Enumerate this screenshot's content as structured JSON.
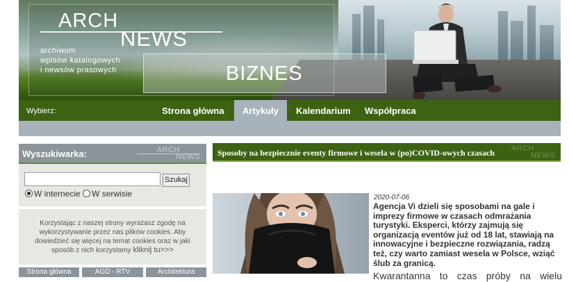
{
  "banner": {
    "logo_arch": "ARCH",
    "logo_news": "NEWS",
    "subtitle_lines": [
      "archiwum",
      "wpisów katalogowych",
      "i newsów prasowych"
    ],
    "section": "BIZNES"
  },
  "nav": {
    "prompt": "Wybierz:",
    "items": [
      "Strona główna",
      "Artykuły",
      "Kalendarium",
      "Współpraca"
    ],
    "active": "Artykuły"
  },
  "search": {
    "title": "Wyszukiwarka:",
    "mini_arch": "ARCH",
    "mini_news": "NEWS",
    "input_value": "",
    "button": "Szukaj",
    "option_internet": "W internecie",
    "option_site": "W serwisie",
    "selected": "W internecie"
  },
  "cookies": {
    "text": "Korzystając z naszej strony wyrażasz zgodę na wykorzystywanie przez nas plików cookies. Aby dowiedzieć się więcej na temat cookies oraz w jaki sposób z nich korzystamy",
    "link": "kliknij tu>>>"
  },
  "categories": [
    "Strona główna",
    "AGD - RTV",
    "Architektura"
  ],
  "article": {
    "title": "Sposoby na bezpiecznie eventy firmowe i wesela w (po)COVID-owych czasach",
    "bar_arch": "ARCH",
    "bar_news": "NEWS",
    "date": "2020-07-06",
    "lead": "Agencja Vi dzieli się sposobami na gale i imprezy firmowe w czasach odmrażania turystyki. Eksperci, którzy zajmują się organizacją eventów już od 18 lat, stawiają na innowacyjne i bezpieczne rozwiązania, radzą też, czy warto zamiast wesela w Polsce, wziąć ślub za granicą.",
    "body_start": "Kwarantanna to czas próby na wielu"
  },
  "colors": {
    "nav_green": "#3c6212",
    "grey_bar": "#a8b2bb",
    "panel_bg": "#e6e9e2",
    "header_grey": "#8c949b"
  }
}
